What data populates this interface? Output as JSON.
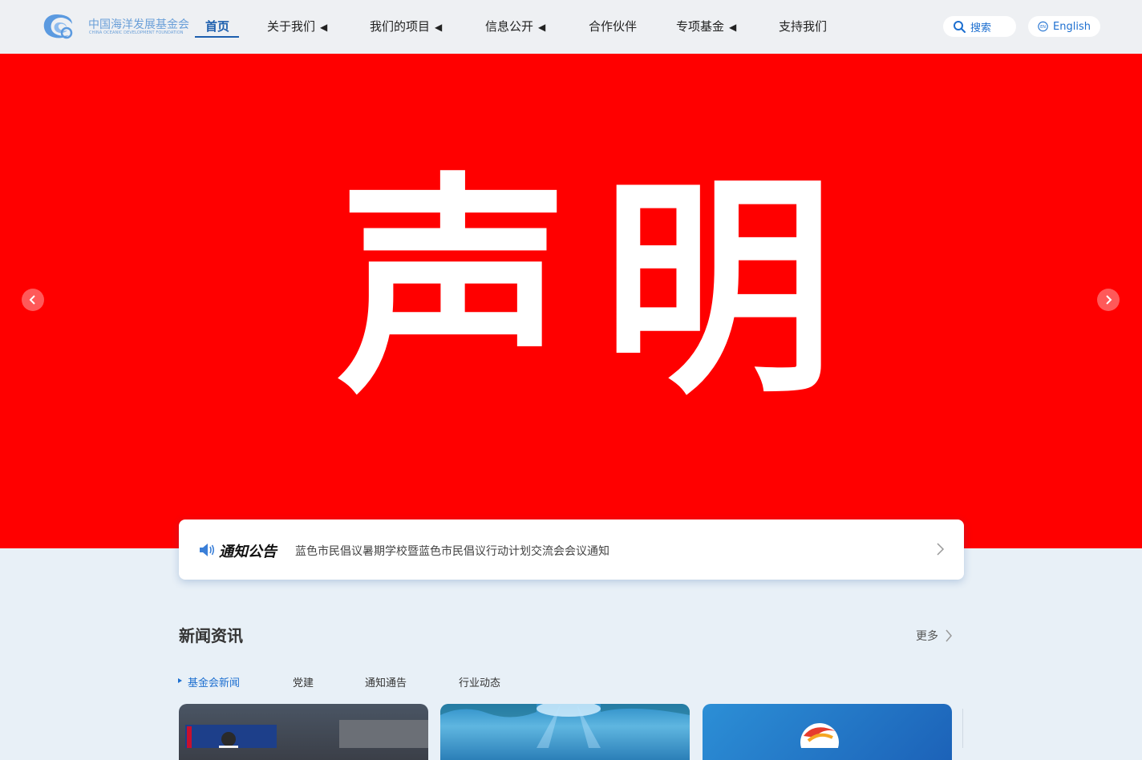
{
  "header": {
    "logo": {
      "name_cn": "中国海洋发展基金会",
      "name_en": "CHINA OCEANIC DEVELOPMENT FOUNDATION"
    },
    "nav": [
      {
        "label": "首页",
        "active": true,
        "has_submenu": false
      },
      {
        "label": "关于我们",
        "active": false,
        "has_submenu": true
      },
      {
        "label": "我们的项目",
        "active": false,
        "has_submenu": true
      },
      {
        "label": "信息公开",
        "active": false,
        "has_submenu": true
      },
      {
        "label": "合作伙伴",
        "active": false,
        "has_submenu": false
      },
      {
        "label": "专项基金",
        "active": false,
        "has_submenu": true
      },
      {
        "label": "支持我们",
        "active": false,
        "has_submenu": false
      }
    ],
    "submenu_arrow": "◀",
    "search_label": "搜索",
    "language": {
      "badge": "EN",
      "label": "English"
    }
  },
  "banner": {
    "text": "声明",
    "background_color": "#ff0000",
    "prev_icon": "chevron-left-icon",
    "next_icon": "chevron-right-icon"
  },
  "notice": {
    "title": "通知公告",
    "text": "蓝色市民倡议暑期学校暨蓝色市民倡议行动计划交流会会议通知"
  },
  "news": {
    "title": "新闻资讯",
    "more_label": "更多",
    "tabs": [
      {
        "label": "基金会新闻",
        "active": true
      },
      {
        "label": "党建",
        "active": false
      },
      {
        "label": "通知通告",
        "active": false
      },
      {
        "label": "行业动态",
        "active": false
      }
    ]
  },
  "colors": {
    "accent": "#1d5fae",
    "link": "#1d6fd0",
    "banner": "#ff0000",
    "page_bg": "#e8f0f7"
  }
}
